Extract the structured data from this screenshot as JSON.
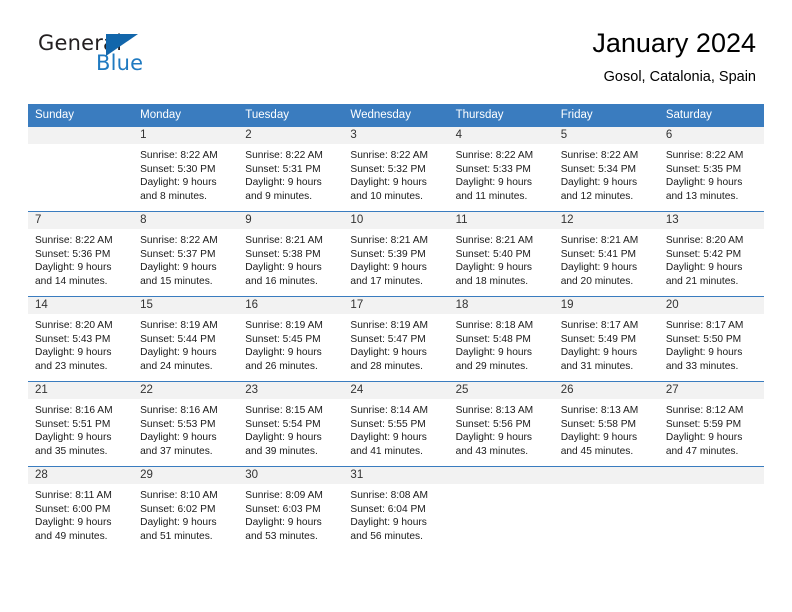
{
  "brand": {
    "general": "General",
    "blue": "Blue",
    "triangle_icon": "blue-triangle-logo"
  },
  "header": {
    "title": "January 2024",
    "subtitle": "Gosol, Catalonia, Spain"
  },
  "colors": {
    "header_blue": "#3a7cbf",
    "band_gray": "#f2f2f2",
    "brand_blue": "#1f7ac1",
    "text": "#000000"
  },
  "weekday_headers": [
    "Sunday",
    "Monday",
    "Tuesday",
    "Wednesday",
    "Thursday",
    "Friday",
    "Saturday"
  ],
  "weeks": [
    [
      {
        "day": "",
        "sunrise": "",
        "sunset": "",
        "daylight1": "",
        "daylight2": ""
      },
      {
        "day": "1",
        "sunrise": "Sunrise: 8:22 AM",
        "sunset": "Sunset: 5:30 PM",
        "daylight1": "Daylight: 9 hours",
        "daylight2": "and 8 minutes."
      },
      {
        "day": "2",
        "sunrise": "Sunrise: 8:22 AM",
        "sunset": "Sunset: 5:31 PM",
        "daylight1": "Daylight: 9 hours",
        "daylight2": "and 9 minutes."
      },
      {
        "day": "3",
        "sunrise": "Sunrise: 8:22 AM",
        "sunset": "Sunset: 5:32 PM",
        "daylight1": "Daylight: 9 hours",
        "daylight2": "and 10 minutes."
      },
      {
        "day": "4",
        "sunrise": "Sunrise: 8:22 AM",
        "sunset": "Sunset: 5:33 PM",
        "daylight1": "Daylight: 9 hours",
        "daylight2": "and 11 minutes."
      },
      {
        "day": "5",
        "sunrise": "Sunrise: 8:22 AM",
        "sunset": "Sunset: 5:34 PM",
        "daylight1": "Daylight: 9 hours",
        "daylight2": "and 12 minutes."
      },
      {
        "day": "6",
        "sunrise": "Sunrise: 8:22 AM",
        "sunset": "Sunset: 5:35 PM",
        "daylight1": "Daylight: 9 hours",
        "daylight2": "and 13 minutes."
      }
    ],
    [
      {
        "day": "7",
        "sunrise": "Sunrise: 8:22 AM",
        "sunset": "Sunset: 5:36 PM",
        "daylight1": "Daylight: 9 hours",
        "daylight2": "and 14 minutes."
      },
      {
        "day": "8",
        "sunrise": "Sunrise: 8:22 AM",
        "sunset": "Sunset: 5:37 PM",
        "daylight1": "Daylight: 9 hours",
        "daylight2": "and 15 minutes."
      },
      {
        "day": "9",
        "sunrise": "Sunrise: 8:21 AM",
        "sunset": "Sunset: 5:38 PM",
        "daylight1": "Daylight: 9 hours",
        "daylight2": "and 16 minutes."
      },
      {
        "day": "10",
        "sunrise": "Sunrise: 8:21 AM",
        "sunset": "Sunset: 5:39 PM",
        "daylight1": "Daylight: 9 hours",
        "daylight2": "and 17 minutes."
      },
      {
        "day": "11",
        "sunrise": "Sunrise: 8:21 AM",
        "sunset": "Sunset: 5:40 PM",
        "daylight1": "Daylight: 9 hours",
        "daylight2": "and 18 minutes."
      },
      {
        "day": "12",
        "sunrise": "Sunrise: 8:21 AM",
        "sunset": "Sunset: 5:41 PM",
        "daylight1": "Daylight: 9 hours",
        "daylight2": "and 20 minutes."
      },
      {
        "day": "13",
        "sunrise": "Sunrise: 8:20 AM",
        "sunset": "Sunset: 5:42 PM",
        "daylight1": "Daylight: 9 hours",
        "daylight2": "and 21 minutes."
      }
    ],
    [
      {
        "day": "14",
        "sunrise": "Sunrise: 8:20 AM",
        "sunset": "Sunset: 5:43 PM",
        "daylight1": "Daylight: 9 hours",
        "daylight2": "and 23 minutes."
      },
      {
        "day": "15",
        "sunrise": "Sunrise: 8:19 AM",
        "sunset": "Sunset: 5:44 PM",
        "daylight1": "Daylight: 9 hours",
        "daylight2": "and 24 minutes."
      },
      {
        "day": "16",
        "sunrise": "Sunrise: 8:19 AM",
        "sunset": "Sunset: 5:45 PM",
        "daylight1": "Daylight: 9 hours",
        "daylight2": "and 26 minutes."
      },
      {
        "day": "17",
        "sunrise": "Sunrise: 8:19 AM",
        "sunset": "Sunset: 5:47 PM",
        "daylight1": "Daylight: 9 hours",
        "daylight2": "and 28 minutes."
      },
      {
        "day": "18",
        "sunrise": "Sunrise: 8:18 AM",
        "sunset": "Sunset: 5:48 PM",
        "daylight1": "Daylight: 9 hours",
        "daylight2": "and 29 minutes."
      },
      {
        "day": "19",
        "sunrise": "Sunrise: 8:17 AM",
        "sunset": "Sunset: 5:49 PM",
        "daylight1": "Daylight: 9 hours",
        "daylight2": "and 31 minutes."
      },
      {
        "day": "20",
        "sunrise": "Sunrise: 8:17 AM",
        "sunset": "Sunset: 5:50 PM",
        "daylight1": "Daylight: 9 hours",
        "daylight2": "and 33 minutes."
      }
    ],
    [
      {
        "day": "21",
        "sunrise": "Sunrise: 8:16 AM",
        "sunset": "Sunset: 5:51 PM",
        "daylight1": "Daylight: 9 hours",
        "daylight2": "and 35 minutes."
      },
      {
        "day": "22",
        "sunrise": "Sunrise: 8:16 AM",
        "sunset": "Sunset: 5:53 PM",
        "daylight1": "Daylight: 9 hours",
        "daylight2": "and 37 minutes."
      },
      {
        "day": "23",
        "sunrise": "Sunrise: 8:15 AM",
        "sunset": "Sunset: 5:54 PM",
        "daylight1": "Daylight: 9 hours",
        "daylight2": "and 39 minutes."
      },
      {
        "day": "24",
        "sunrise": "Sunrise: 8:14 AM",
        "sunset": "Sunset: 5:55 PM",
        "daylight1": "Daylight: 9 hours",
        "daylight2": "and 41 minutes."
      },
      {
        "day": "25",
        "sunrise": "Sunrise: 8:13 AM",
        "sunset": "Sunset: 5:56 PM",
        "daylight1": "Daylight: 9 hours",
        "daylight2": "and 43 minutes."
      },
      {
        "day": "26",
        "sunrise": "Sunrise: 8:13 AM",
        "sunset": "Sunset: 5:58 PM",
        "daylight1": "Daylight: 9 hours",
        "daylight2": "and 45 minutes."
      },
      {
        "day": "27",
        "sunrise": "Sunrise: 8:12 AM",
        "sunset": "Sunset: 5:59 PM",
        "daylight1": "Daylight: 9 hours",
        "daylight2": "and 47 minutes."
      }
    ],
    [
      {
        "day": "28",
        "sunrise": "Sunrise: 8:11 AM",
        "sunset": "Sunset: 6:00 PM",
        "daylight1": "Daylight: 9 hours",
        "daylight2": "and 49 minutes."
      },
      {
        "day": "29",
        "sunrise": "Sunrise: 8:10 AM",
        "sunset": "Sunset: 6:02 PM",
        "daylight1": "Daylight: 9 hours",
        "daylight2": "and 51 minutes."
      },
      {
        "day": "30",
        "sunrise": "Sunrise: 8:09 AM",
        "sunset": "Sunset: 6:03 PM",
        "daylight1": "Daylight: 9 hours",
        "daylight2": "and 53 minutes."
      },
      {
        "day": "31",
        "sunrise": "Sunrise: 8:08 AM",
        "sunset": "Sunset: 6:04 PM",
        "daylight1": "Daylight: 9 hours",
        "daylight2": "and 56 minutes."
      },
      {
        "day": "",
        "sunrise": "",
        "sunset": "",
        "daylight1": "",
        "daylight2": ""
      },
      {
        "day": "",
        "sunrise": "",
        "sunset": "",
        "daylight1": "",
        "daylight2": ""
      },
      {
        "day": "",
        "sunrise": "",
        "sunset": "",
        "daylight1": "",
        "daylight2": ""
      }
    ]
  ]
}
